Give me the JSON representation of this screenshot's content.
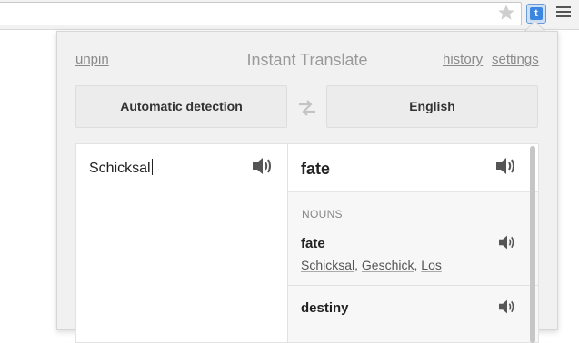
{
  "browser": {
    "star_icon": "star-icon",
    "extension_icon_letter": "t",
    "menu_icon": "hamburger-icon"
  },
  "popup": {
    "title": "Instant Translate",
    "unpin_label": "unpin",
    "history_label": "history",
    "settings_label": "settings",
    "source_language": "Automatic detection",
    "target_language": "English",
    "swap_icon": "swap-arrows-icon"
  },
  "source": {
    "text": "Schicksal",
    "speaker_icon": "speaker-icon"
  },
  "result": {
    "main_translation": "fate",
    "part_of_speech": "NOUNS",
    "entries": [
      {
        "word": "fate",
        "synonyms": [
          "Schicksal",
          "Geschick",
          "Los"
        ]
      },
      {
        "word": "destiny"
      }
    ]
  }
}
